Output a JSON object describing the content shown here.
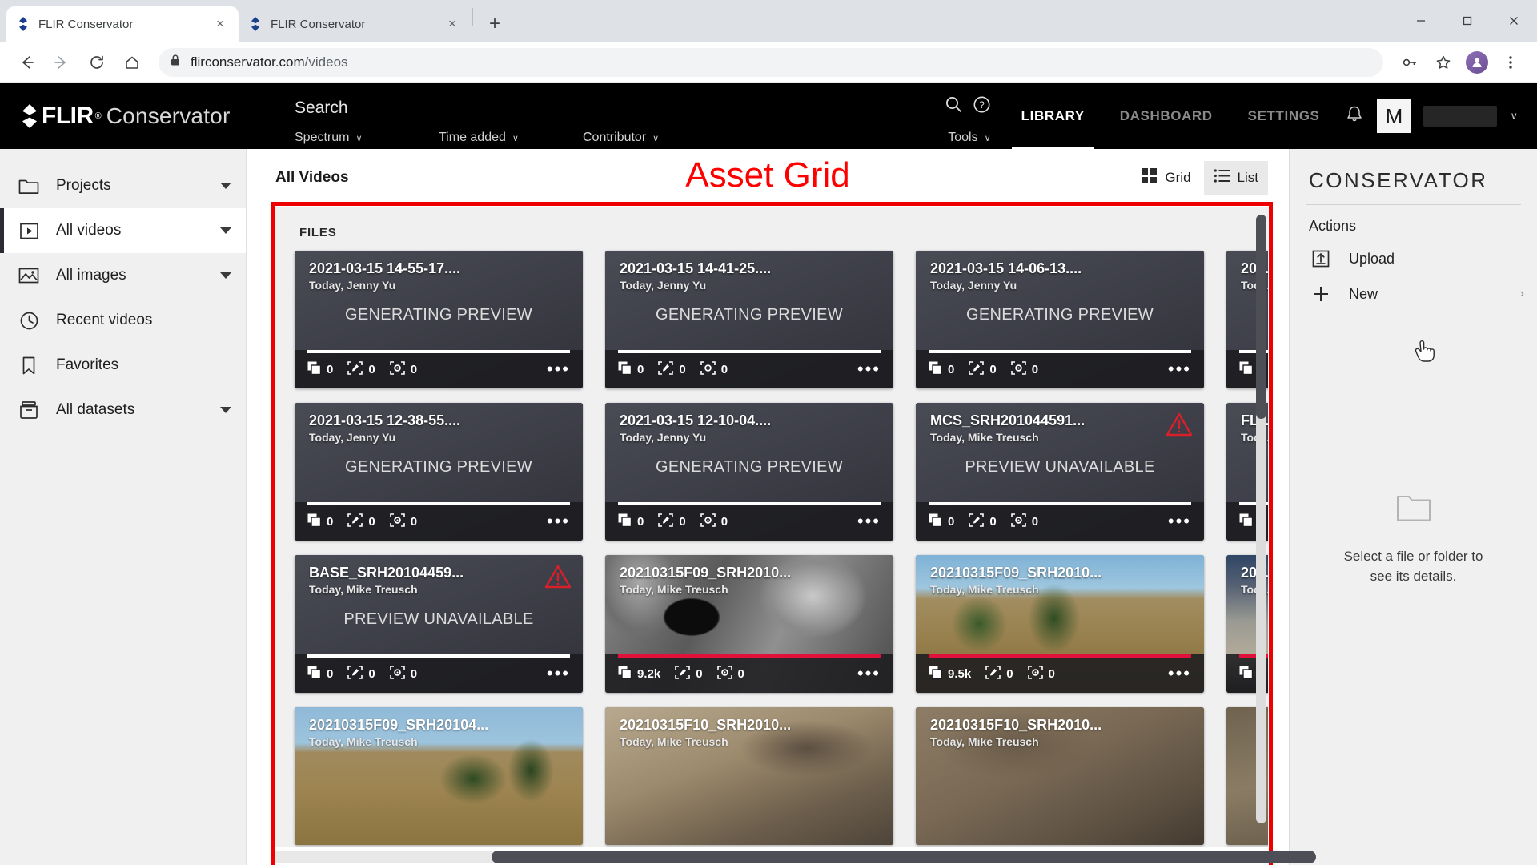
{
  "browser": {
    "tabs": [
      {
        "title": "FLIR Conservator",
        "active": true,
        "favicon": "flir-diamond-icon"
      },
      {
        "title": "FLIR Conservator",
        "active": false,
        "favicon": "flir-diamond-icon"
      }
    ],
    "new_tab_label": "+",
    "close_label": "×",
    "window_controls": [
      "minimize",
      "maximize",
      "close"
    ],
    "url": "flirconservator.com/videos",
    "url_domain": "flirconservator.com",
    "url_path": "/videos",
    "nav_icons": [
      "back-icon",
      "forward-icon",
      "reload-icon",
      "home-icon"
    ],
    "lock_icon": "lock-icon",
    "toolbar_right_icons": [
      "key-icon",
      "bookmark-star-icon",
      "profile-avatar",
      "kebab-menu-icon"
    ]
  },
  "header": {
    "brand_flir": "FLIR",
    "brand_registered": "®",
    "brand_product": "Conservator",
    "search_placeholder": "Search",
    "search_icon": "search-icon",
    "help_icon": "help-circle-icon",
    "filters": [
      {
        "label": "Spectrum",
        "caret": "∨"
      },
      {
        "label": "Time added",
        "caret": "∨"
      },
      {
        "label": "Contributor",
        "caret": "∨"
      },
      {
        "label": "Tools",
        "caret": "∨"
      }
    ],
    "nav": [
      {
        "label": "LIBRARY",
        "active": true
      },
      {
        "label": "DASHBOARD",
        "active": false
      },
      {
        "label": "SETTINGS",
        "active": false
      }
    ],
    "bell_icon": "notification-bell-icon",
    "avatar_initial": "M",
    "username": "",
    "user_caret": "∨"
  },
  "sidebar": {
    "items": [
      {
        "label": "Projects",
        "icon": "folder-icon",
        "expandable": true,
        "active": false
      },
      {
        "label": "All videos",
        "icon": "video-play-icon",
        "expandable": true,
        "active": true
      },
      {
        "label": "All images",
        "icon": "image-icon",
        "expandable": true,
        "active": false
      },
      {
        "label": "Recent videos",
        "icon": "clock-icon",
        "expandable": false,
        "active": false
      },
      {
        "label": "Favorites",
        "icon": "bookmark-icon",
        "expandable": false,
        "active": false
      },
      {
        "label": "All datasets",
        "icon": "dataset-icon",
        "expandable": true,
        "active": false
      }
    ]
  },
  "content": {
    "breadcrumb": "All Videos",
    "annotation_label": "Asset Grid",
    "annotation_color": "#ff0000",
    "view_toggle": [
      {
        "label": "Grid",
        "icon": "grid-view-icon",
        "hovered": false
      },
      {
        "label": "List",
        "icon": "list-view-icon",
        "hovered": true
      }
    ],
    "files_label": "FILES",
    "cards": [
      {
        "title": "2021-03-15 14-55-17....",
        "subtitle": "Today, Jenny Yu",
        "status": "GENERATING PREVIEW",
        "thumb": "gradient",
        "frames": "0",
        "boxes": "0",
        "tags": "0",
        "progress": "white",
        "warning": false,
        "menu": "•••"
      },
      {
        "title": "2021-03-15 14-41-25....",
        "subtitle": "Today, Jenny Yu",
        "status": "GENERATING PREVIEW",
        "thumb": "gradient",
        "frames": "0",
        "boxes": "0",
        "tags": "0",
        "progress": "white",
        "warning": false,
        "menu": "•••"
      },
      {
        "title": "2021-03-15 14-06-13....",
        "subtitle": "Today, Jenny Yu",
        "status": "GENERATING PREVIEW",
        "thumb": "gradient",
        "frames": "0",
        "boxes": "0",
        "tags": "0",
        "progress": "white",
        "warning": false,
        "menu": "•••"
      },
      {
        "title": "20...",
        "subtitle": "Tod...",
        "status": "",
        "thumb": "gradient",
        "frames": "",
        "boxes": "",
        "tags": "",
        "progress": "white",
        "warning": false,
        "menu": ""
      },
      {
        "title": "2021-03-15 12-38-55....",
        "subtitle": "Today, Jenny Yu",
        "status": "GENERATING PREVIEW",
        "thumb": "gradient",
        "frames": "0",
        "boxes": "0",
        "tags": "0",
        "progress": "white",
        "warning": false,
        "menu": "•••"
      },
      {
        "title": "2021-03-15 12-10-04....",
        "subtitle": "Today, Jenny Yu",
        "status": "GENERATING PREVIEW",
        "thumb": "gradient",
        "frames": "0",
        "boxes": "0",
        "tags": "0",
        "progress": "white",
        "warning": false,
        "menu": "•••"
      },
      {
        "title": "MCS_SRH201044591...",
        "subtitle": "Today, Mike Treusch",
        "status": "PREVIEW UNAVAILABLE",
        "thumb": "gradient",
        "frames": "0",
        "boxes": "0",
        "tags": "0",
        "progress": "white",
        "warning": true,
        "menu": "•••"
      },
      {
        "title": "FLY...",
        "subtitle": "Tod...",
        "status": "",
        "thumb": "gradient",
        "frames": "",
        "boxes": "",
        "tags": "",
        "progress": "white",
        "warning": false,
        "menu": ""
      },
      {
        "title": "BASE_SRH20104459...",
        "subtitle": "Today, Mike Treusch",
        "status": "PREVIEW UNAVAILABLE",
        "thumb": "gradient",
        "frames": "0",
        "boxes": "0",
        "tags": "0",
        "progress": "white",
        "warning": true,
        "menu": "•••"
      },
      {
        "title": "20210315F09_SRH2010...",
        "subtitle": "Today, Mike Treusch",
        "status": "",
        "thumb": "thermal",
        "frames": "9.2k",
        "boxes": "0",
        "tags": "0",
        "progress": "red",
        "warning": false,
        "menu": "•••"
      },
      {
        "title": "20210315F09_SRH2010...",
        "subtitle": "Today, Mike Treusch",
        "status": "",
        "thumb": "field2",
        "frames": "9.5k",
        "boxes": "0",
        "tags": "0",
        "progress": "red",
        "warning": false,
        "menu": "•••"
      },
      {
        "title": "20...",
        "subtitle": "Tod...",
        "status": "",
        "thumb": "night",
        "frames": "",
        "boxes": "",
        "tags": "",
        "progress": "red",
        "warning": false,
        "menu": ""
      },
      {
        "title": "20210315F09_SRH20104...",
        "subtitle": "Today, Mike Treusch",
        "status": "",
        "thumb": "field1",
        "frames": "",
        "boxes": "",
        "tags": "",
        "progress": "",
        "warning": false,
        "menu": ""
      },
      {
        "title": "20210315F10_SRH2010...",
        "subtitle": "Today, Mike Treusch",
        "status": "",
        "thumb": "dirt1",
        "frames": "",
        "boxes": "",
        "tags": "",
        "progress": "",
        "warning": false,
        "menu": ""
      },
      {
        "title": "20210315F10_SRH2010...",
        "subtitle": "Today, Mike Treusch",
        "status": "",
        "thumb": "dirt2",
        "frames": "",
        "boxes": "",
        "tags": "",
        "progress": "",
        "warning": false,
        "menu": ""
      },
      {
        "title": "",
        "subtitle": "",
        "status": "",
        "thumb": "dirt3",
        "frames": "",
        "boxes": "",
        "tags": "",
        "progress": "",
        "warning": false,
        "menu": ""
      }
    ]
  },
  "right_panel": {
    "title": "CONSERVATOR",
    "section_label": "Actions",
    "actions": [
      {
        "label": "Upload",
        "icon": "upload-icon",
        "chevron": ""
      },
      {
        "label": "New",
        "icon": "plus-icon",
        "chevron": "›"
      }
    ],
    "empty_icon": "folder-outline-icon",
    "empty_line1": "Select a file or folder to",
    "empty_line2": "see its details."
  }
}
